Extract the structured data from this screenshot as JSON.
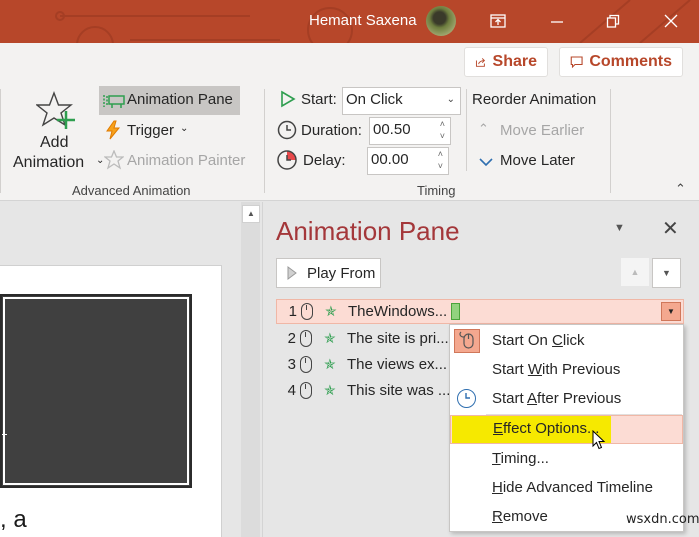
{
  "titlebar": {
    "user_name": "Hemant Saxena",
    "buttons": [
      "ribbon-display-options",
      "minimize",
      "restore",
      "close"
    ],
    "accent": "#b7472a"
  },
  "ribbon": {
    "share_label": "Share",
    "comments_label": "Comments",
    "advanced_animation": {
      "group_label": "Advanced Animation",
      "add_animation_line1": "Add",
      "add_animation_line2": "Animation",
      "animation_pane_label": "Animation Pane",
      "trigger_label": "Trigger",
      "animation_painter_label": "Animation Painter"
    },
    "timing": {
      "group_label": "Timing",
      "start_label": "Start:",
      "start_value": "On Click",
      "duration_label": "Duration:",
      "duration_value": "00.50",
      "delay_label": "Delay:",
      "delay_value": "00.00"
    },
    "reorder": {
      "title": "Reorder Animation",
      "move_earlier_label": "Move Earlier",
      "move_later_label": "Move Later"
    }
  },
  "slide": {
    "visible_text": ", a"
  },
  "animation_pane": {
    "title": "Animation Pane",
    "play_from_label": "Play From",
    "items": [
      {
        "number": "1",
        "label": "TheWindows...",
        "selected": true
      },
      {
        "number": "2",
        "label": "The site is pri...",
        "selected": false
      },
      {
        "number": "3",
        "label": "The views ex...",
        "selected": false
      },
      {
        "number": "4",
        "label": "This site was ...",
        "selected": false
      }
    ]
  },
  "context_menu": {
    "items": [
      {
        "pre": "Start On ",
        "ul": "C",
        "post": "lick",
        "icon": "mouse-click-icon"
      },
      {
        "pre": "Start ",
        "ul": "W",
        "post": "ith Previous",
        "icon": ""
      },
      {
        "pre": "Start ",
        "ul": "A",
        "post": "fter Previous",
        "icon": "clock-icon"
      },
      {
        "pre": "",
        "ul": "E",
        "post": "ffect Options...",
        "icon": "",
        "hovered": true
      },
      {
        "pre": "",
        "ul": "T",
        "post": "iming...",
        "icon": ""
      },
      {
        "pre": "",
        "ul": "H",
        "post": "ide Advanced Timeline",
        "icon": ""
      },
      {
        "pre": "",
        "ul": "R",
        "post": "emove",
        "icon": ""
      }
    ]
  },
  "watermark": "wsxdn.com"
}
